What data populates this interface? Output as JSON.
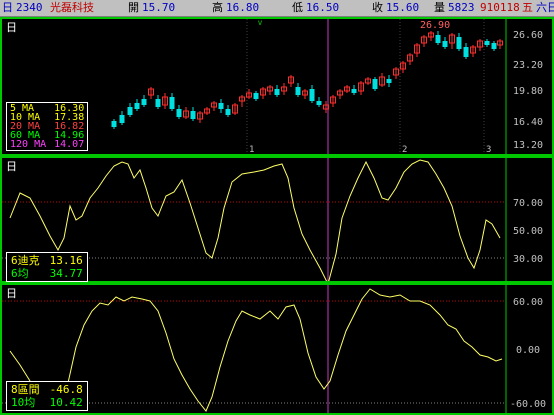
{
  "header": {
    "period": "日",
    "code": "2340",
    "name": "光磊科技",
    "open_label": "開",
    "open_value": "15.70",
    "high_label": "高",
    "high_value": "16.80",
    "low_label": "低",
    "low_value": "16.50",
    "close_label": "收",
    "close_value": "15.60",
    "volume_label": "量",
    "volume_value": "5823",
    "date_value": "910118",
    "date_unit": "五",
    "extra": "六日"
  },
  "colors": {
    "frame": "#00c800",
    "up": "#ff3030",
    "down": "#00e0e0",
    "line": "#ffff66",
    "cursor": "#c040c0",
    "ref_red": "#c80000",
    "ref_gray": "#808080"
  },
  "price_panel": {
    "period": "日",
    "high_marker": "26.90",
    "y_ticks": [
      "26.60",
      "23.20",
      "19.80",
      "16.40",
      "13.20"
    ],
    "x_ticks": [
      "1",
      "2",
      "3"
    ],
    "ma_legend": [
      {
        "label": "5 MA",
        "value": "16.30",
        "color": "#ffff00"
      },
      {
        "label": "10 MA",
        "value": "17.38",
        "color": "#ffff00"
      },
      {
        "label": "20 MA",
        "value": "16.82",
        "color": "#ff4040"
      },
      {
        "label": "60 MA",
        "value": "14.96",
        "color": "#00ff00"
      },
      {
        "label": "120 MA",
        "value": "14.07",
        "color": "#ff40ff"
      }
    ]
  },
  "kd_panel": {
    "period": "日",
    "y_ticks": [
      "70.00",
      "50.00",
      "30.00"
    ],
    "legend": [
      {
        "label": "6迪克",
        "value": "13.16",
        "color": "#ffff00"
      },
      {
        "label": "6均",
        "value": "34.77",
        "color": "#00ff00"
      }
    ]
  },
  "osc_panel": {
    "period": "日",
    "y_ticks": [
      "60.00",
      "0.00",
      "-60.00"
    ],
    "legend": [
      {
        "label": "8區間",
        "value": "-46.8",
        "color": "#ffff00"
      },
      {
        "label": "10均",
        "value": "10.42",
        "color": "#00ff00"
      }
    ]
  }
}
